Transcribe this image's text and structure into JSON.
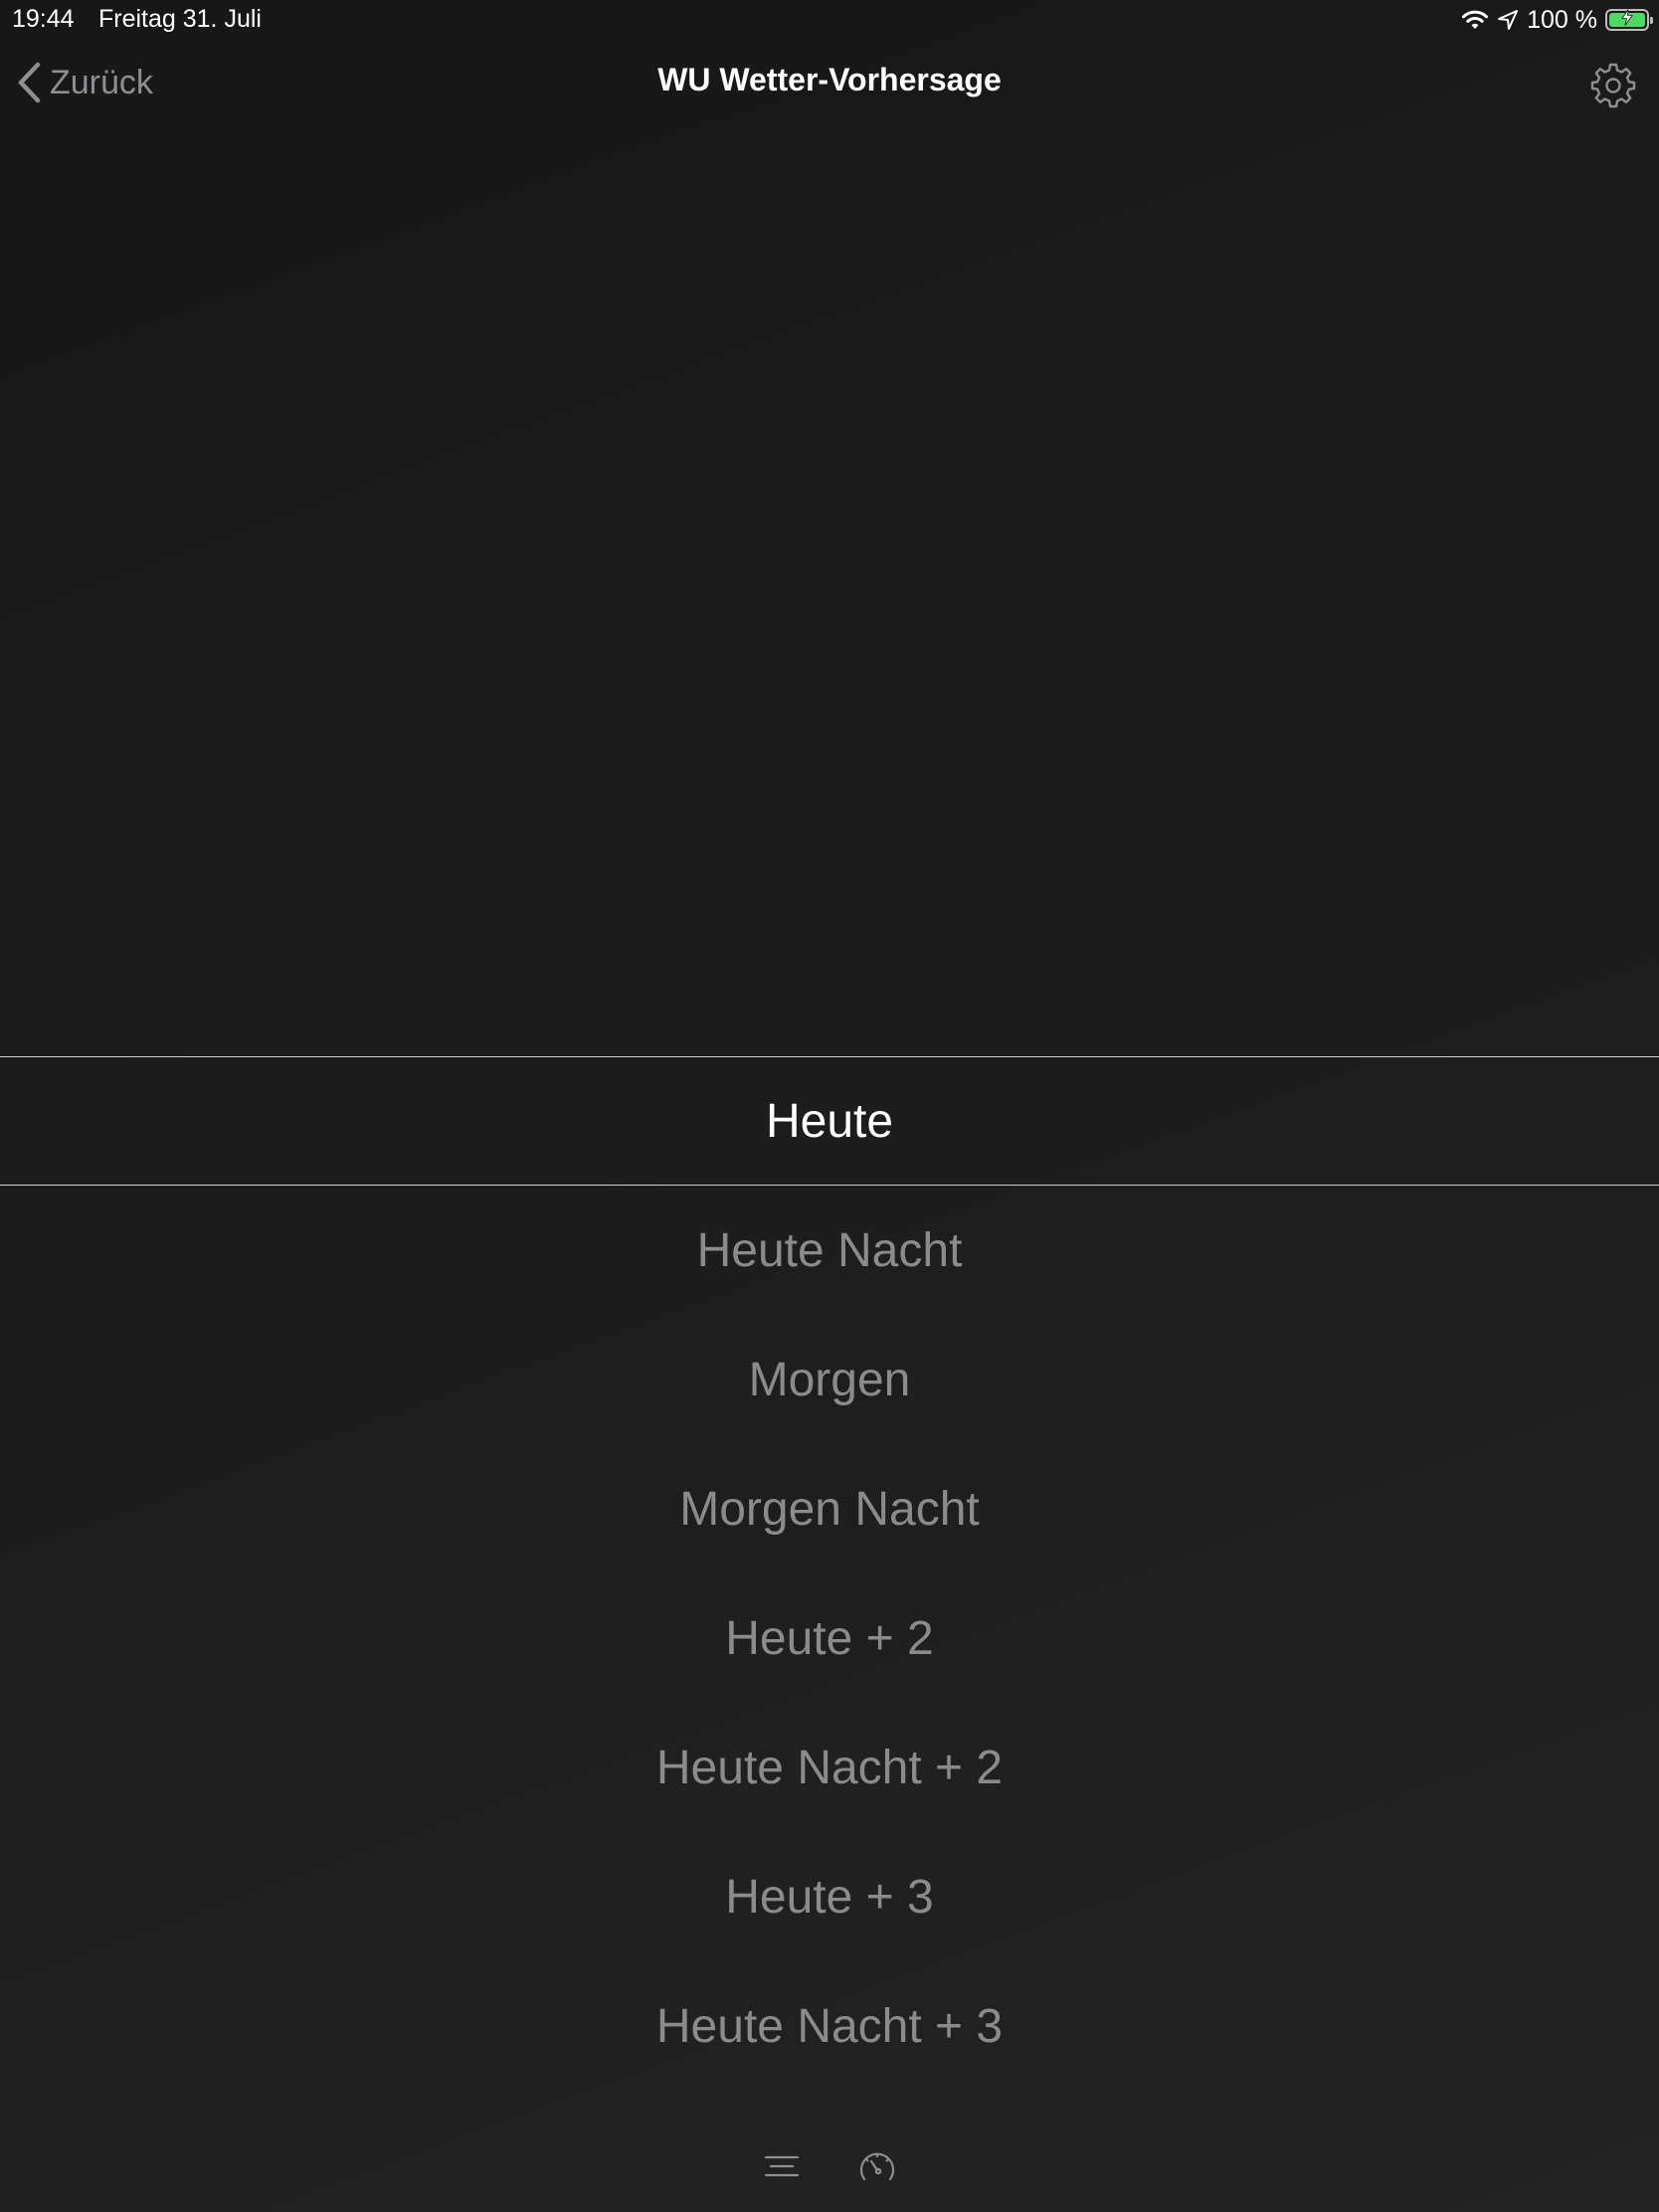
{
  "status_bar": {
    "time": "19:44",
    "date": "Freitag 31. Juli",
    "battery_text": "100 %",
    "battery_level": 1.0,
    "icons": [
      "wifi-icon",
      "location-arrow-icon",
      "battery-charging-icon"
    ]
  },
  "nav": {
    "back_label": "Zurück",
    "title": "WU Wetter-Vorhersage",
    "settings_icon": "gear-icon"
  },
  "picker": {
    "selected": "Heute",
    "items": [
      "Heute Nacht",
      "Morgen",
      "Morgen Nacht",
      "Heute + 2",
      "Heute Nacht + 2",
      "Heute + 3",
      "Heute Nacht + 3"
    ]
  },
  "toolbar": {
    "icons": [
      "list-icon",
      "gauge-icon"
    ]
  },
  "colors": {
    "background": "#1c1c1c",
    "text_primary": "#ffffff",
    "text_secondary": "#8b8b8b",
    "battery": "#4cd964"
  }
}
